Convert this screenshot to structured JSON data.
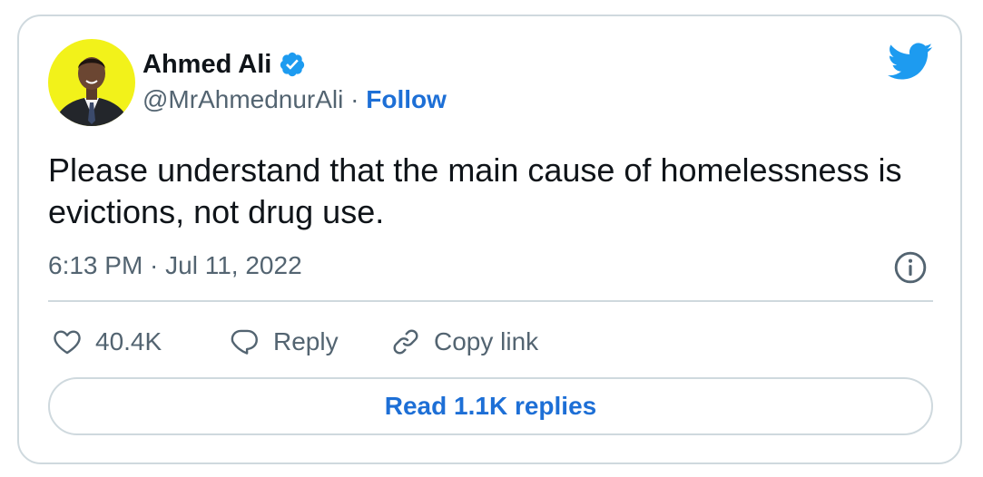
{
  "author": {
    "name": "Ahmed Ali",
    "handle": "@MrAhmednurAli",
    "separator": "·",
    "follow_label": "Follow",
    "verified": true
  },
  "tweet": {
    "text": "Please understand that the main cause of homelessness is evictions, not drug use.",
    "timestamp": "6:13 PM · Jul 11, 2022"
  },
  "actions": {
    "like_count": "40.4K",
    "reply_label": "Reply",
    "copy_link_label": "Copy link"
  },
  "footer": {
    "read_replies_label": "Read 1.1K replies"
  },
  "colors": {
    "accent": "#1d6fd6",
    "twitter_blue": "#1d9bf0",
    "text_primary": "#0f1419",
    "text_secondary": "#536471",
    "border": "#cfd9de",
    "avatar_background": "#f2f21a"
  },
  "icons": {
    "brand": "twitter-bird-icon",
    "verified": "verified-badge-icon",
    "info": "info-icon",
    "like": "heart-icon",
    "reply": "speech-bubble-icon",
    "copy_link": "link-icon"
  }
}
